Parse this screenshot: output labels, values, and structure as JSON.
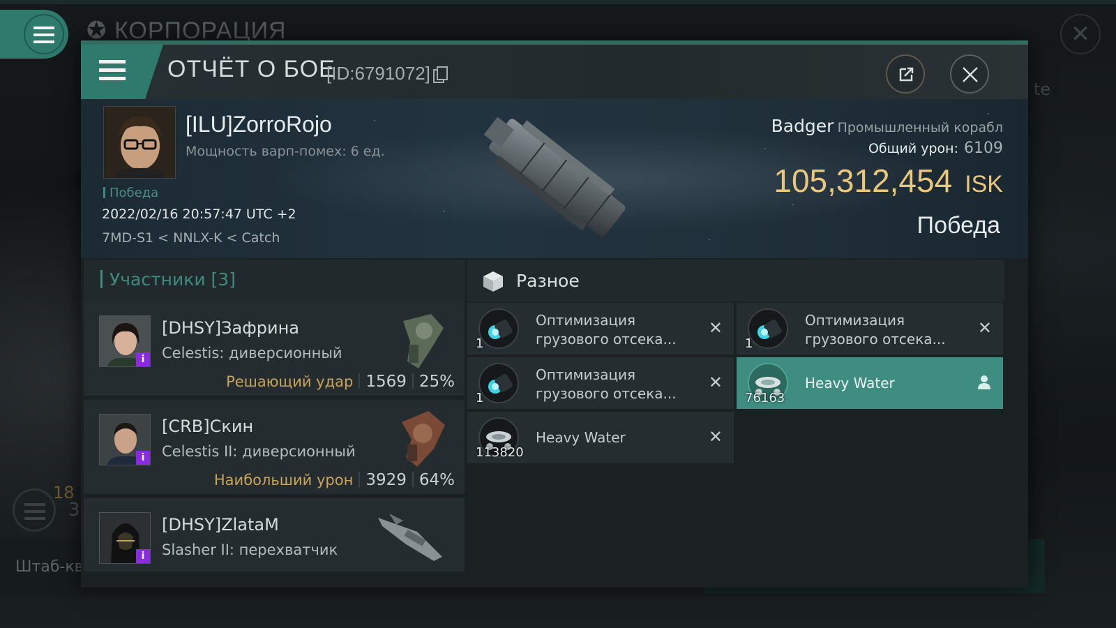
{
  "background": {
    "title": "КОРПОРАЦИЯ",
    "side_text": "te",
    "num_a": "18",
    "num_b": "3",
    "bottom_left": "Штаб-ква"
  },
  "header": {
    "title": "ОТЧЁТ О БОЕ",
    "id": "[ID:6791072]"
  },
  "victim": {
    "name": "[ILU]ZorroRojo",
    "warp": "Мощность варп-помех: 6 ед.",
    "result": "Победа",
    "datetime": "2022/02/16 20:57:47 UTC +2",
    "location": "7MD-S1 < NNLX-K < Catch",
    "ship_name": "Badger",
    "ship_class": "Промышленный корабл",
    "damage_label": "Общий урон:",
    "damage_value": "6109",
    "isk_amount": "105,312,454",
    "isk_currency": "ISK",
    "outcome": "Победа"
  },
  "participants": {
    "header": "Участники [3]",
    "rows": [
      {
        "name": "[DHSY]Зафрина",
        "ship": "Celestis: диверсионный",
        "tag": "Решающий удар",
        "damage": "1569",
        "percent": "25%",
        "badge": "i"
      },
      {
        "name": "[CRB]Скин",
        "ship": "Celestis II: диверсионный",
        "tag": "Наибольший урон",
        "damage": "3929",
        "percent": "64%",
        "badge": "i"
      },
      {
        "name": "[DHSY]ZlataM",
        "ship": "Slasher II: перехватчик",
        "badge": "i"
      }
    ]
  },
  "items": {
    "header": "Разное",
    "list": [
      {
        "line1": "Оптимизация",
        "line2": "грузового отсека...",
        "qty": "1",
        "mark": "✕",
        "status": "destroyed"
      },
      {
        "line1": "Оптимизация",
        "line2": "грузового отсека...",
        "qty": "1",
        "mark": "✕",
        "status": "destroyed"
      },
      {
        "line1": "Оптимизация",
        "line2": "грузового отсека...",
        "qty": "1",
        "mark": "✕",
        "status": "destroyed"
      },
      {
        "line1": "Heavy Water",
        "qty": "76163",
        "status": "dropped"
      },
      {
        "line1": "Heavy Water",
        "qty": "113820",
        "mark": "✕",
        "status": "destroyed"
      }
    ]
  },
  "colors": {
    "accent": "#2f7a6d",
    "isk": "#e9c77e",
    "tag": "#c9a45a",
    "badge": "#8a2be2",
    "dropped": "#3e8d80"
  }
}
